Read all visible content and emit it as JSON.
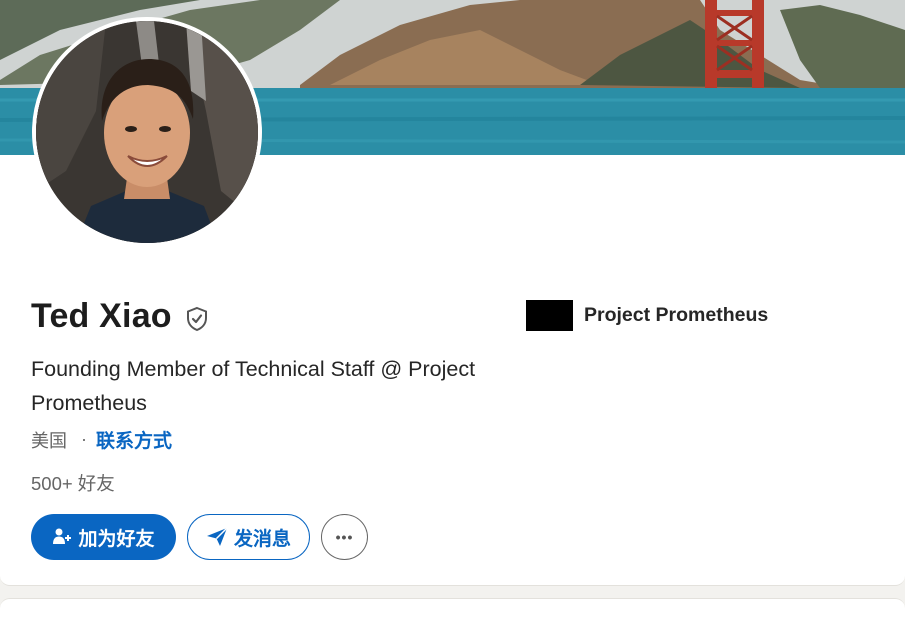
{
  "profile": {
    "name": "Ted Xiao",
    "headline": "Founding Member of Technical Staff @ Project Prometheus",
    "location": "美国",
    "location_separator": "·",
    "contact_info_label": "联系方式",
    "connections": "500+ 好友"
  },
  "company": {
    "name": "Project Prometheus"
  },
  "actions": {
    "connect_label": "加为好友",
    "message_label": "发消息",
    "more_label": "•••"
  },
  "icons": {
    "verified": "verified-shield-icon",
    "connect": "add-person-icon",
    "message": "send-plane-icon",
    "more": "more-dots-icon"
  },
  "colors": {
    "accent": "#0a66c2",
    "text": "#1d1d1d",
    "muted": "#666666"
  }
}
